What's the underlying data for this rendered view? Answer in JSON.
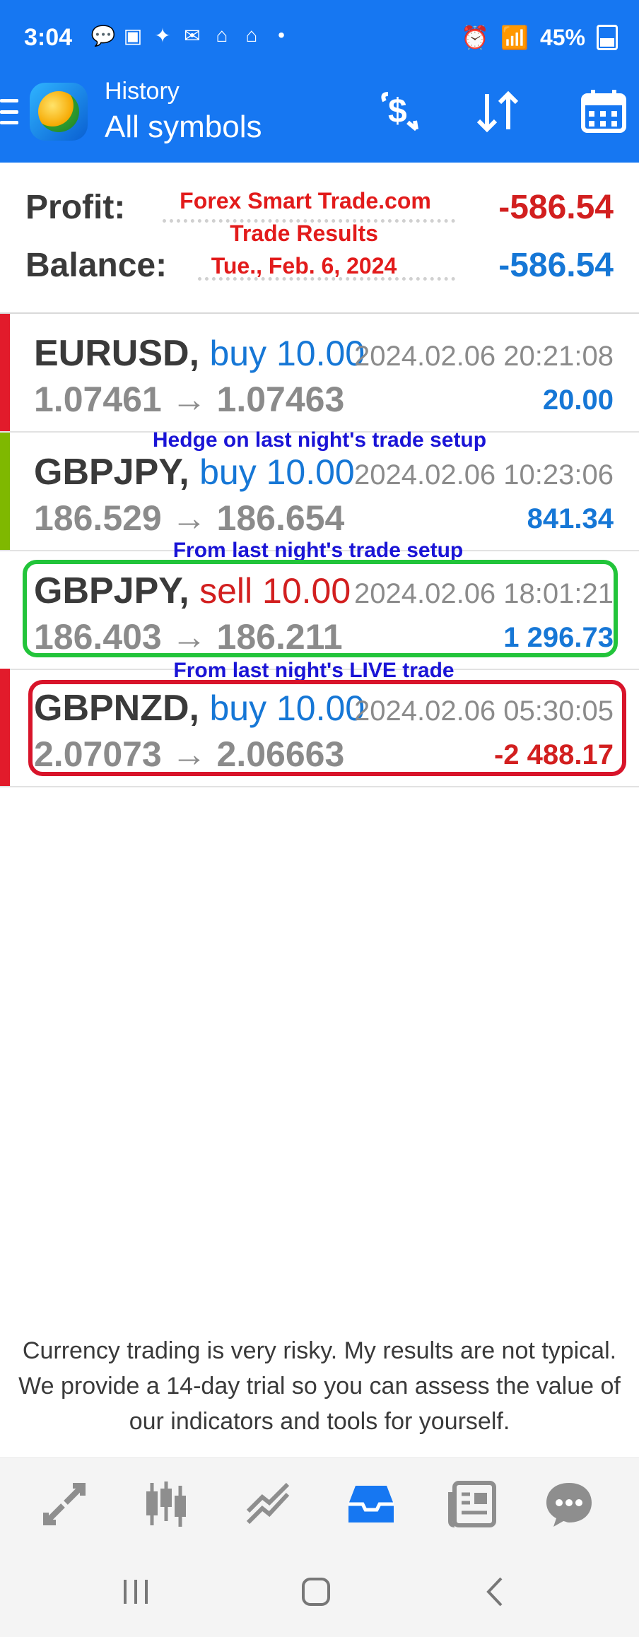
{
  "status": {
    "time": "3:04",
    "battery": "45%"
  },
  "appbar": {
    "title_small": "History",
    "title_large": "All symbols"
  },
  "summary": {
    "profit_label": "Profit:",
    "profit_value": "-586.54",
    "balance_label": "Balance:",
    "balance_value": "-586.54",
    "overlay": {
      "line1": "Forex Smart Trade.com",
      "line2": "Trade Results",
      "line3": "Tue., Feb. 6, 2024"
    }
  },
  "trades": [
    {
      "symbol": "EURUSD,",
      "side": "buy 10.00",
      "time": "2024.02.06 20:21:08",
      "prices": "1.07461 → 1.07463",
      "pnl": "20.00"
    },
    {
      "symbol": "GBPJPY,",
      "side": "buy 10.00",
      "time": "2024.02.06 10:23:06",
      "prices": "186.529 → 186.654",
      "pnl": "841.34"
    },
    {
      "symbol": "GBPJPY,",
      "side": "sell 10.00",
      "time": "2024.02.06 18:01:21",
      "prices": "186.403 → 186.211",
      "pnl": "1 296.73"
    },
    {
      "symbol": "GBPNZD,",
      "side": "buy 10.00",
      "time": "2024.02.06 05:30:05",
      "prices": "2.07073 → 2.06663",
      "pnl": "-2 488.17"
    }
  ],
  "annotations": {
    "a1": "Hedge on last night's trade setup",
    "a2": "From last night's trade setup",
    "a3": "From last night's LIVE trade"
  },
  "disclaimer": "Currency trading is very risky. My results are not typical. We provide a 14-day trial so you can assess the value of our indicators and tools for yourself.",
  "colors": {
    "brand_blue": "#1677f2",
    "buy_blue": "#1677d6",
    "sell_red": "#d21f1f",
    "marker_red": "#e21b2b",
    "marker_green": "#7fb800",
    "box_green": "#22c43a",
    "box_red": "#d8142a"
  }
}
